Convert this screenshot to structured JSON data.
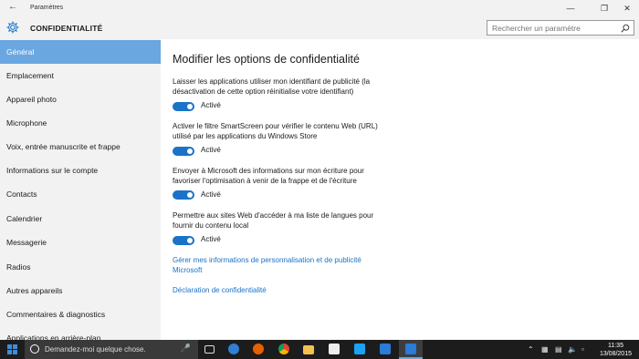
{
  "window": {
    "title": "Paramètres"
  },
  "header": {
    "app_title": "CONFIDENTIALITÉ"
  },
  "search": {
    "placeholder": "Rechercher un paramètre"
  },
  "sidebar": {
    "items": [
      {
        "label": "Général"
      },
      {
        "label": "Emplacement"
      },
      {
        "label": "Appareil photo"
      },
      {
        "label": "Microphone"
      },
      {
        "label": "Voix, entrée manuscrite et frappe"
      },
      {
        "label": "Informations sur le compte"
      },
      {
        "label": "Contacts"
      },
      {
        "label": "Calendrier"
      },
      {
        "label": "Messagerie"
      },
      {
        "label": "Radios"
      },
      {
        "label": "Autres appareils"
      },
      {
        "label": "Commentaires & diagnostics"
      },
      {
        "label": "Applications en arrière-plan"
      }
    ]
  },
  "main": {
    "heading": "Modifier les options de confidentialité",
    "options": [
      {
        "text": "Laisser les applications utiliser mon identifiant de publicité (la désactivation de cette option réinitialise votre identifiant)",
        "state": "Activé"
      },
      {
        "text": "Activer le filtre SmartScreen pour vérifier le contenu Web (URL) utilisé par les applications du Windows Store",
        "state": "Activé"
      },
      {
        "text": "Envoyer à Microsoft des informations sur mon écriture pour favoriser l'optimisation à venir de la frappe et de l'écriture",
        "state": "Activé"
      },
      {
        "text": "Permettre aux sites Web d'accéder à ma liste de langues pour fournir du contenu local",
        "state": "Activé"
      }
    ],
    "links": [
      {
        "label": "Gérer mes informations de personnalisation et de publicité Microsoft"
      },
      {
        "label": "Déclaration de confidentialité"
      }
    ]
  },
  "taskbar": {
    "search_text": "Demandez-moi quelque chose.",
    "time": "11:35",
    "date": "13/08/2015"
  },
  "colors": {
    "accent": "#1a73c7",
    "nav_active": "#6aa7e0"
  }
}
